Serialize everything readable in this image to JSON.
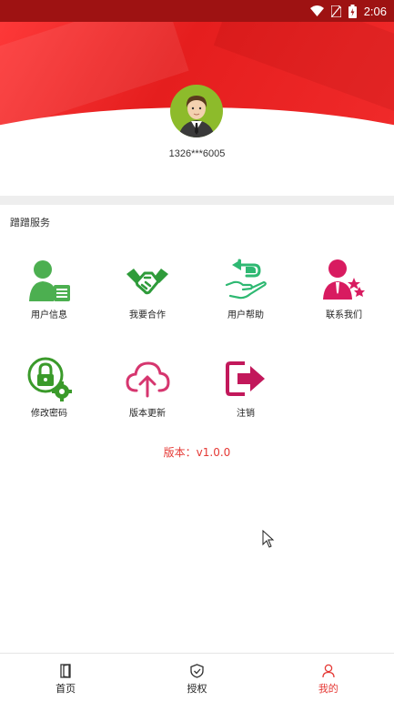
{
  "status_bar": {
    "time": "2:06"
  },
  "profile": {
    "phone": "1326***6005"
  },
  "service": {
    "title": "蹭蹭服务",
    "items": [
      {
        "label": "用户信息",
        "icon": "user-info-icon",
        "color": "#4caf50"
      },
      {
        "label": "我要合作",
        "icon": "handshake-icon",
        "color": "#2e9b3a"
      },
      {
        "label": "用户帮助",
        "icon": "help-hand-icon",
        "color": "#2eb872"
      },
      {
        "label": "联系我们",
        "icon": "contact-icon",
        "color": "#d81b60"
      },
      {
        "label": "修改密码",
        "icon": "lock-gear-icon",
        "color": "#3a9a2a"
      },
      {
        "label": "版本更新",
        "icon": "cloud-upload-icon",
        "color": "#d6366f"
      },
      {
        "label": "注销",
        "icon": "logout-icon",
        "color": "#c2185b"
      }
    ]
  },
  "version_text": "版本：v1.0.0",
  "tabbar": {
    "tabs": [
      {
        "label": "首页",
        "icon": "door-icon",
        "active": false
      },
      {
        "label": "授权",
        "icon": "shield-icon",
        "active": false
      },
      {
        "label": "我的",
        "icon": "person-icon",
        "active": true
      }
    ]
  },
  "colors": {
    "accent": "#e53935",
    "header": "#f02a2a"
  }
}
